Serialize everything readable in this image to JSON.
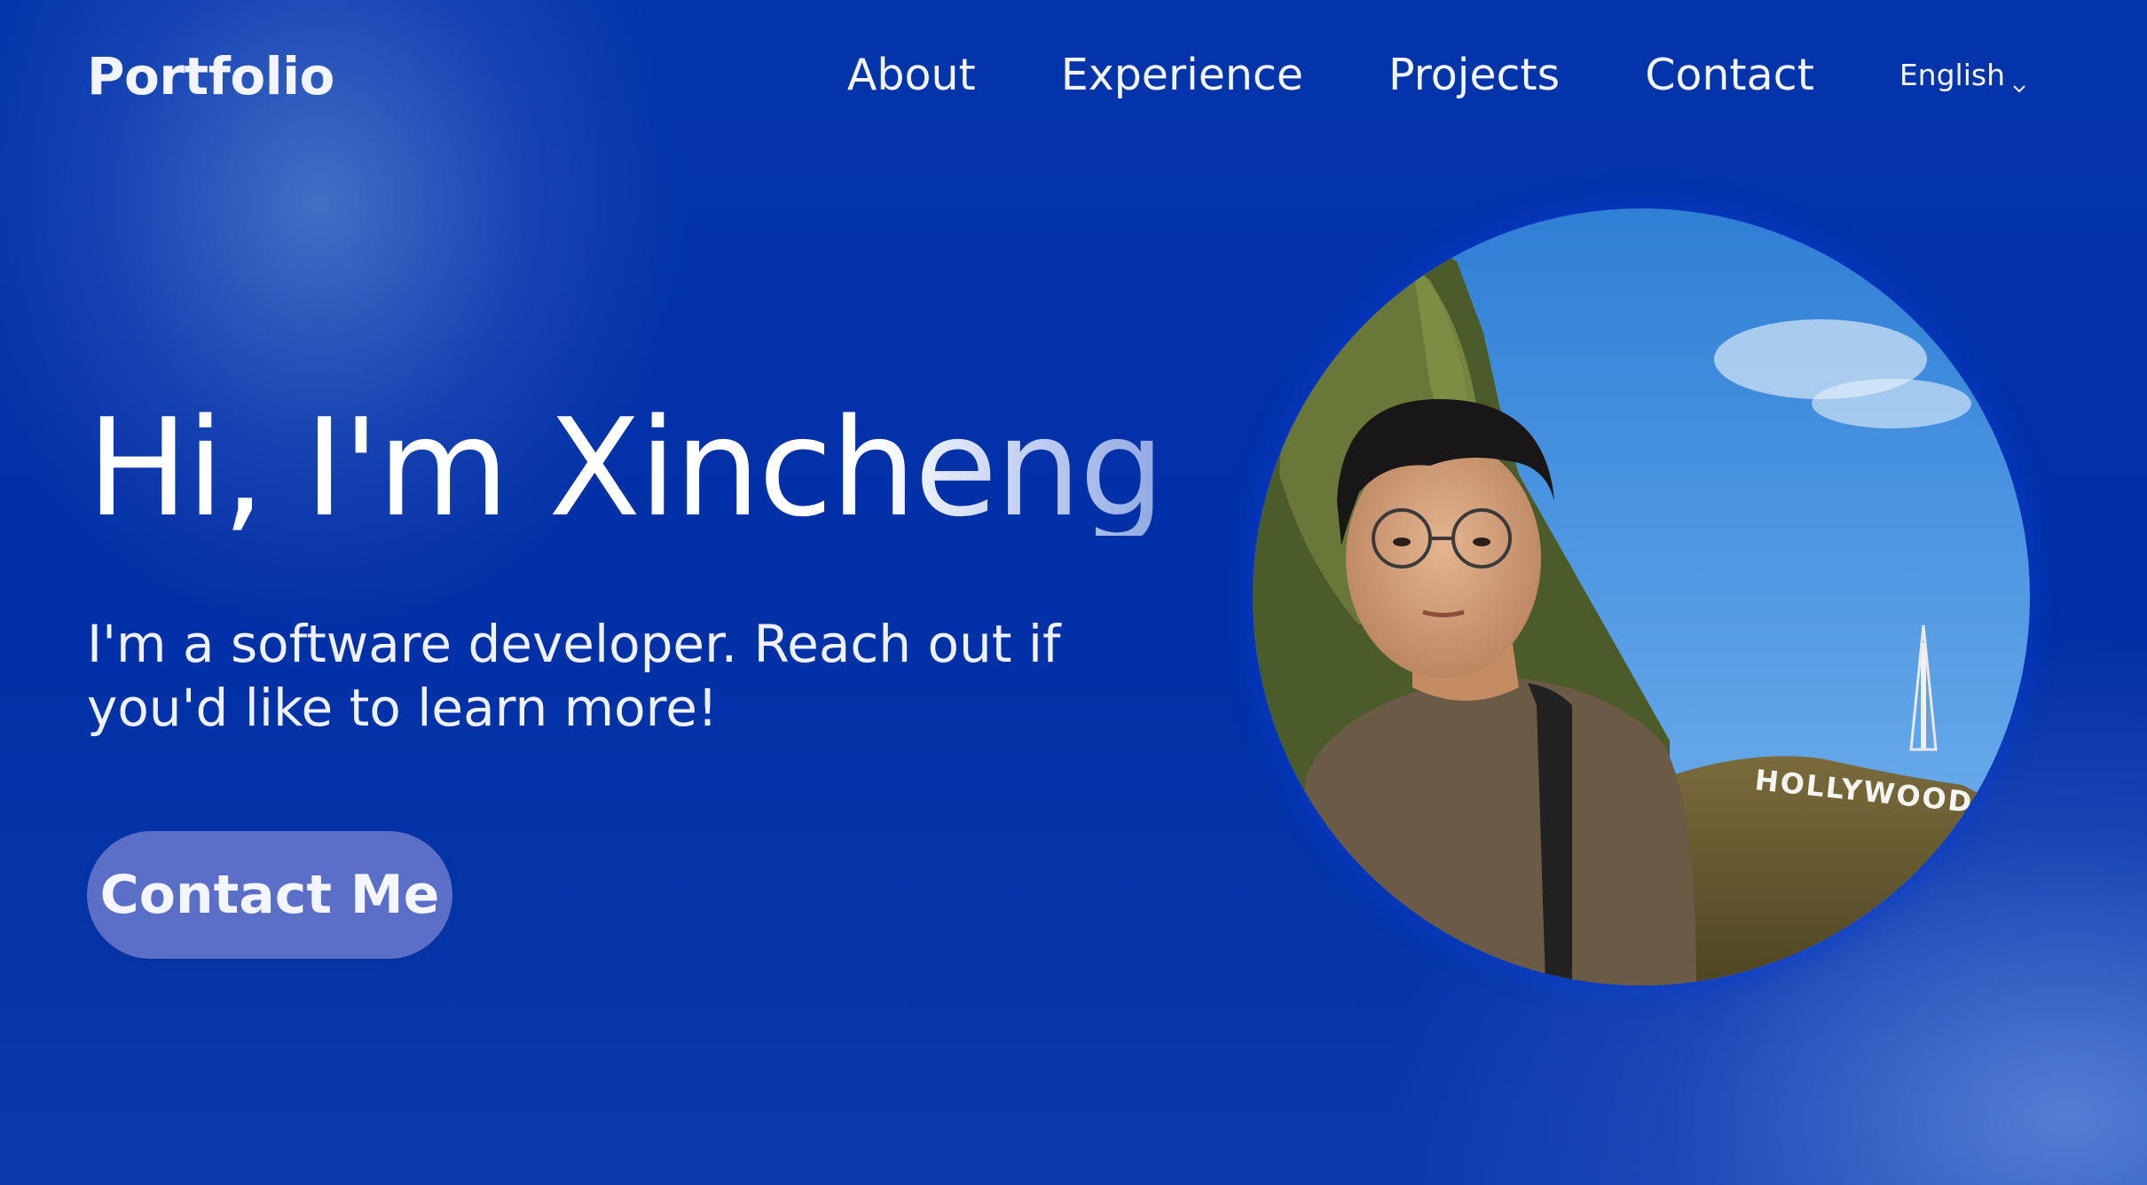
{
  "nav": {
    "brand": "Portfolio",
    "links": [
      "About",
      "Experience",
      "Projects",
      "Contact"
    ],
    "language": "English"
  },
  "hero": {
    "title": "Hi, I'm Xincheng",
    "subtitle": "I'm a software developer. Reach out if you'd like to learn more!",
    "cta_label": "Contact Me",
    "photo_sign_text": "HOLLYWOOD"
  },
  "icons": {
    "language_dropdown": "chevron-down-icon"
  },
  "colors": {
    "background": "#0131a9",
    "button": "#5c6fc8",
    "text": "#ffffff"
  }
}
